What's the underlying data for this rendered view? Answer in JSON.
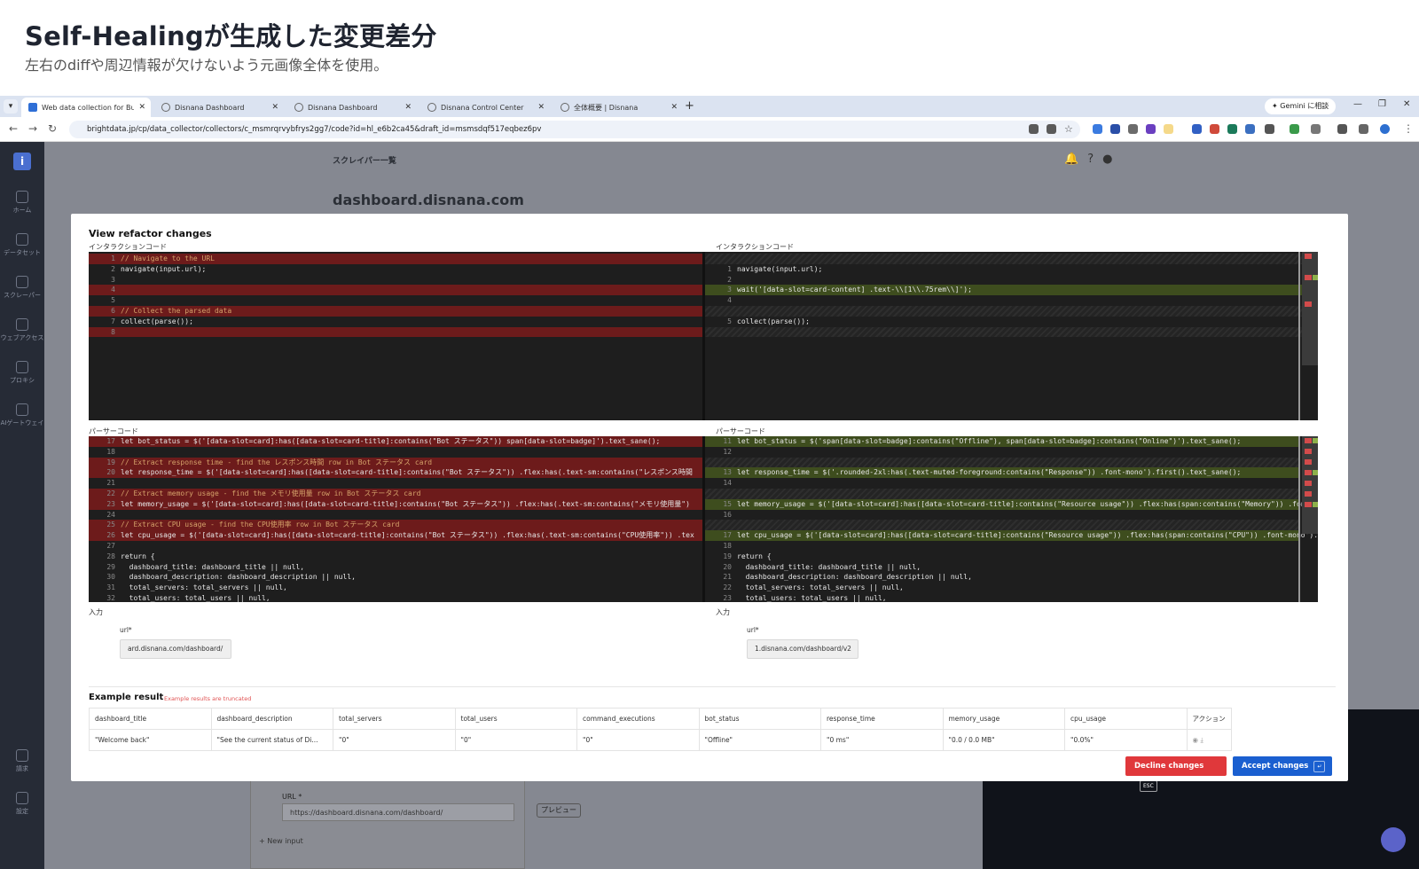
{
  "slide": {
    "title": "Self-Healingが生成した変更差分",
    "subtitle": "左右のdiffや周辺情報が欠けないよう元画像全体を使用。"
  },
  "browser": {
    "tabs": [
      {
        "label": "Web data collection for Busines",
        "active": true
      },
      {
        "label": "Disnana Dashboard"
      },
      {
        "label": "Disnana Dashboard"
      },
      {
        "label": "Disnana Control Center"
      },
      {
        "label": "全体概要 | Disnana"
      }
    ],
    "new_tab": "+",
    "gemini_button": "✦ Gemini に相談",
    "url": "brightdata.jp/cp/data_collector/collectors/c_msmrqrvybfrys2gg7/code?id=hl_e6b2ca45&draft_id=msmsdqf517eqbez6pv"
  },
  "sidebar": {
    "items": [
      {
        "label": "ホーム",
        "icon": "home-icon"
      },
      {
        "label": "データセット",
        "icon": "dataset-icon"
      },
      {
        "label": "スクレーパー",
        "icon": "scraper-icon"
      },
      {
        "label": "ウェブアクセス",
        "icon": "web-access-icon"
      },
      {
        "label": "プロキシ",
        "icon": "proxy-icon"
      },
      {
        "label": "AIゲートウェイ",
        "icon": "ai-gateway-icon"
      },
      {
        "label": "請求",
        "icon": "billing-icon"
      },
      {
        "label": "設定",
        "icon": "settings-icon"
      }
    ]
  },
  "background": {
    "breadcrumb": "スクレイパー一覧",
    "scraper_title": "dashboard.disnana.com",
    "url_label": "URL *",
    "url_value": "https://dashboard.disnana.com/dashboard/",
    "preview_button": "プレビュー",
    "new_input": "+ New input"
  },
  "modal": {
    "title": "View refactor changes",
    "interaction_label": "インタラクションコード",
    "parser_label": "パーサーコード",
    "input_label": "入力",
    "left_interaction": [
      {
        "n": "1",
        "type": "del",
        "code": "// Navigate to the URL",
        "cmt": true
      },
      {
        "n": "2",
        "type": "",
        "code": "navigate(input.url);"
      },
      {
        "n": "3",
        "type": "",
        "code": ""
      },
      {
        "n": "4",
        "type": "del",
        "code": ""
      },
      {
        "n": "5",
        "type": "",
        "code": ""
      },
      {
        "n": "6",
        "type": "del",
        "code": "// Collect the parsed data",
        "cmt": true
      },
      {
        "n": "7",
        "type": "",
        "code": "collect(parse());"
      },
      {
        "n": "8",
        "type": "del",
        "code": ""
      }
    ],
    "right_interaction": [
      {
        "n": "",
        "type": "blank",
        "code": ""
      },
      {
        "n": "1",
        "type": "",
        "code": "navigate(input.url);"
      },
      {
        "n": "2",
        "type": "",
        "code": ""
      },
      {
        "n": "3",
        "type": "add",
        "code": "wait('[data-slot=card-content] .text-\\\\[1\\\\.75rem\\\\]');"
      },
      {
        "n": "4",
        "type": "",
        "code": ""
      },
      {
        "n": "",
        "type": "blank",
        "code": ""
      },
      {
        "n": "5",
        "type": "",
        "code": "collect(parse());"
      },
      {
        "n": "",
        "type": "blank",
        "code": ""
      }
    ],
    "left_parser": [
      {
        "n": "17",
        "type": "del",
        "code": "let bot_status = $('[data-slot=card]:has([data-slot=card-title]:contains(\"Bot ステータス\")) span[data-slot=badge]').text_sane();"
      },
      {
        "n": "18",
        "type": "",
        "code": ""
      },
      {
        "n": "19",
        "type": "del",
        "code": "// Extract response time - find the レスポンス時間 row in Bot ステータス card",
        "cmt": true
      },
      {
        "n": "20",
        "type": "del",
        "code": "let response_time = $('[data-slot=card]:has([data-slot=card-title]:contains(\"Bot ステータス\")) .flex:has(.text-sm:contains(\"レスポンス時間"
      },
      {
        "n": "21",
        "type": "",
        "code": ""
      },
      {
        "n": "22",
        "type": "del",
        "code": "// Extract memory usage - find the メモリ使用量 row in Bot ステータス card",
        "cmt": true
      },
      {
        "n": "23",
        "type": "del",
        "code": "let memory_usage = $('[data-slot=card]:has([data-slot=card-title]:contains(\"Bot ステータス\")) .flex:has(.text-sm:contains(\"メモリ使用量\")"
      },
      {
        "n": "24",
        "type": "",
        "code": ""
      },
      {
        "n": "25",
        "type": "del",
        "code": "// Extract CPU usage - find the CPU使用率 row in Bot ステータス card",
        "cmt": true
      },
      {
        "n": "26",
        "type": "del",
        "code": "let cpu_usage = $('[data-slot=card]:has([data-slot=card-title]:contains(\"Bot ステータス\")) .flex:has(.text-sm:contains(\"CPU使用率\")) .tex"
      },
      {
        "n": "27",
        "type": "",
        "code": ""
      },
      {
        "n": "28",
        "type": "",
        "code": "return {"
      },
      {
        "n": "29",
        "type": "",
        "code": "  dashboard_title: dashboard_title || null,"
      },
      {
        "n": "30",
        "type": "",
        "code": "  dashboard_description: dashboard_description || null,"
      },
      {
        "n": "31",
        "type": "",
        "code": "  total_servers: total_servers || null,"
      },
      {
        "n": "32",
        "type": "",
        "code": "  total_users: total_users || null,"
      }
    ],
    "right_parser": [
      {
        "n": "11",
        "type": "add",
        "code": "let bot_status = $('span[data-slot=badge]:contains(\"Offline\"), span[data-slot=badge]:contains(\"Online\")').text_sane();"
      },
      {
        "n": "12",
        "type": "",
        "code": ""
      },
      {
        "n": "",
        "type": "blank",
        "code": ""
      },
      {
        "n": "13",
        "type": "add",
        "code": "let response_time = $('.rounded-2xl:has(.text-muted-foreground:contains(\"Response\")) .font-mono').first().text_sane();"
      },
      {
        "n": "14",
        "type": "",
        "code": ""
      },
      {
        "n": "",
        "type": "blank",
        "code": ""
      },
      {
        "n": "15",
        "type": "add",
        "code": "let memory_usage = $('[data-slot=card]:has([data-slot=card-title]:contains(\"Resource usage\")) .flex:has(span:contains(\"Memory\")) .font-mono"
      },
      {
        "n": "16",
        "type": "",
        "code": ""
      },
      {
        "n": "",
        "type": "blank",
        "code": ""
      },
      {
        "n": "17",
        "type": "add",
        "code": "let cpu_usage = $('[data-slot=card]:has([data-slot=card-title]:contains(\"Resource usage\")) .flex:has(span:contains(\"CPU\")) .font-mono').te"
      },
      {
        "n": "18",
        "type": "",
        "code": ""
      },
      {
        "n": "19",
        "type": "",
        "code": "return {"
      },
      {
        "n": "20",
        "type": "",
        "code": "  dashboard_title: dashboard_title || null,"
      },
      {
        "n": "21",
        "type": "",
        "code": "  dashboard_description: dashboard_description || null,"
      },
      {
        "n": "22",
        "type": "",
        "code": "  total_servers: total_servers || null,"
      },
      {
        "n": "23",
        "type": "",
        "code": "  total_users: total_users || null,"
      }
    ],
    "left_input": {
      "label": "url*",
      "value": "ard.disnana.com/dashboard/"
    },
    "right_input": {
      "label": "url*",
      "value": "1.disnana.com/dashboard/v2"
    },
    "result": {
      "title": "Example result",
      "note": "Example results are truncated",
      "headers": [
        "dashboard_title",
        "dashboard_description",
        "total_servers",
        "total_users",
        "command_executions",
        "bot_status",
        "response_time",
        "memory_usage",
        "cpu_usage",
        "アクション"
      ],
      "row": [
        "\"Welcome back\"",
        "\"See the current status of Di...",
        "\"0\"",
        "\"0\"",
        "\"0\"",
        "\"Offline\"",
        "\"0 ms\"",
        "\"0.0 / 0.0 MB\"",
        "\"0.0%\""
      ]
    },
    "decline_button": "Decline changes",
    "decline_key": "ESC",
    "accept_button": "Accept changes",
    "accept_key": "↵"
  },
  "colors": {
    "accent": "#1a5fd0",
    "decline": "#e0383b",
    "diff_removed": "#6d1b1b",
    "diff_added": "#3e4d1e"
  }
}
